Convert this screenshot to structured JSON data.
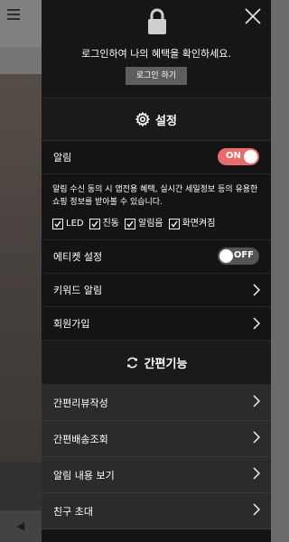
{
  "login": {
    "message": "로그인하여 나의 혜택을 확인하세요.",
    "button_label": "로그인 하기"
  },
  "settings": {
    "title": "설정",
    "notification": {
      "label": "알림",
      "toggle": "ON",
      "notice": "알림 수신 동의 시 앱전용 혜택, 실시간 세일정보 등의 유용한 쇼핑 정보를 받아볼 수 있습니다.",
      "options": [
        {
          "label": "LED",
          "checked": true
        },
        {
          "label": "진동",
          "checked": true
        },
        {
          "label": "알림음",
          "checked": true
        },
        {
          "label": "화면켜짐",
          "checked": true
        }
      ]
    },
    "etiquette": {
      "label": "에티켓 설정",
      "toggle": "OFF"
    },
    "keyword_alarm": "키워드 알림",
    "signup": "회원가입"
  },
  "quick": {
    "title": "간편기능",
    "items": [
      "간편리뷰작성",
      "간편배송조회",
      "알림 내용 보기",
      "친구 초대"
    ]
  },
  "colors": {
    "toggle_on": "#e96b6b",
    "toggle_off": "#555555",
    "drawer_bg": "#141414"
  },
  "icons": [
    "lock-icon",
    "close-icon",
    "gear-icon",
    "refresh-icon",
    "chevron-right-icon",
    "checkmark-icon"
  ]
}
